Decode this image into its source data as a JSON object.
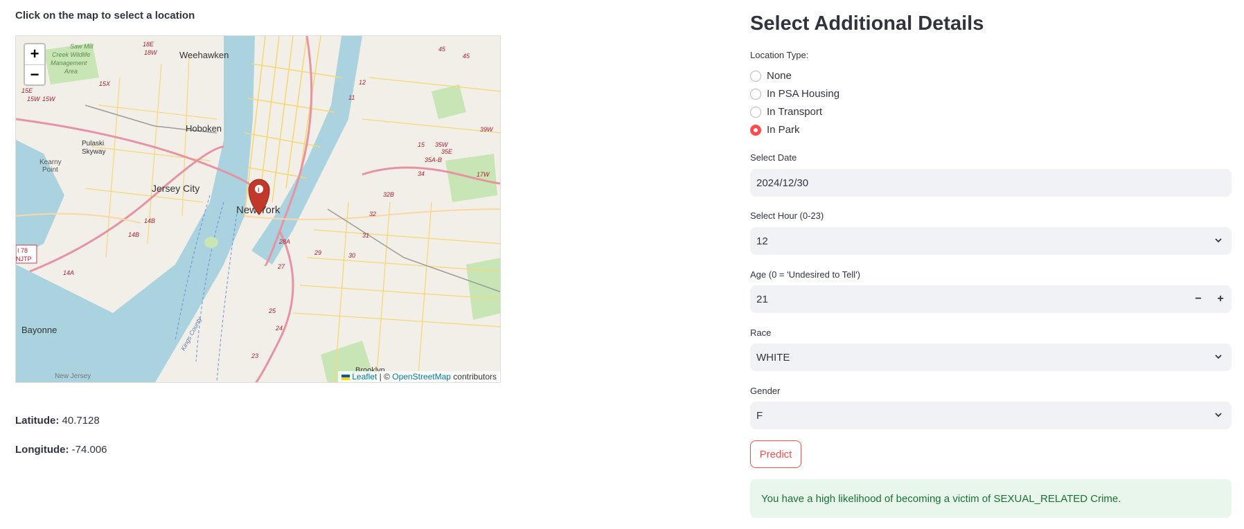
{
  "map": {
    "caption": "Click on the map to select a location",
    "zoom_in": "+",
    "zoom_out": "−",
    "marker_label": "i",
    "places": [
      "Weehawken",
      "Hoboken",
      "Jersey City",
      "New York",
      "Bayonne",
      "Pulaski Skyway",
      "Kearny Point",
      "Saw Mill Creek Wildlife Management Area",
      "Brooklyn",
      "New Jersey",
      "I 78 NJTP",
      "Kings County"
    ],
    "attribution": {
      "leaflet": "Leaflet",
      "separator": " | © ",
      "osm": "OpenStreetMap",
      "suffix": " contributors"
    }
  },
  "coords": {
    "lat_label": "Latitude:",
    "lat_value": " 40.7128",
    "lon_label": "Longitude:",
    "lon_value": " -74.006"
  },
  "form": {
    "title": "Select Additional Details",
    "location_type_label": "Location Type:",
    "location_options": [
      "None",
      "In PSA Housing",
      "In Transport",
      "In Park"
    ],
    "location_selected": "In Park",
    "date_label": "Select Date",
    "date_value": "2024/12/30",
    "hour_label": "Select Hour (0-23)",
    "hour_value": "12",
    "age_label": "Age (0 = 'Undesired to Tell')",
    "age_value": "21",
    "age_minus": "−",
    "age_plus": "+",
    "race_label": "Race",
    "race_value": "WHITE",
    "gender_label": "Gender",
    "gender_value": "F",
    "predict_label": "Predict",
    "result_text": "You have a high likelihood of becoming a victim of SEXUAL_RELATED Crime."
  },
  "colors": {
    "accent": "#ff4b4b",
    "success_bg": "#e9f6ec",
    "success_text": "#177233",
    "input_bg": "#f0f2f6"
  }
}
